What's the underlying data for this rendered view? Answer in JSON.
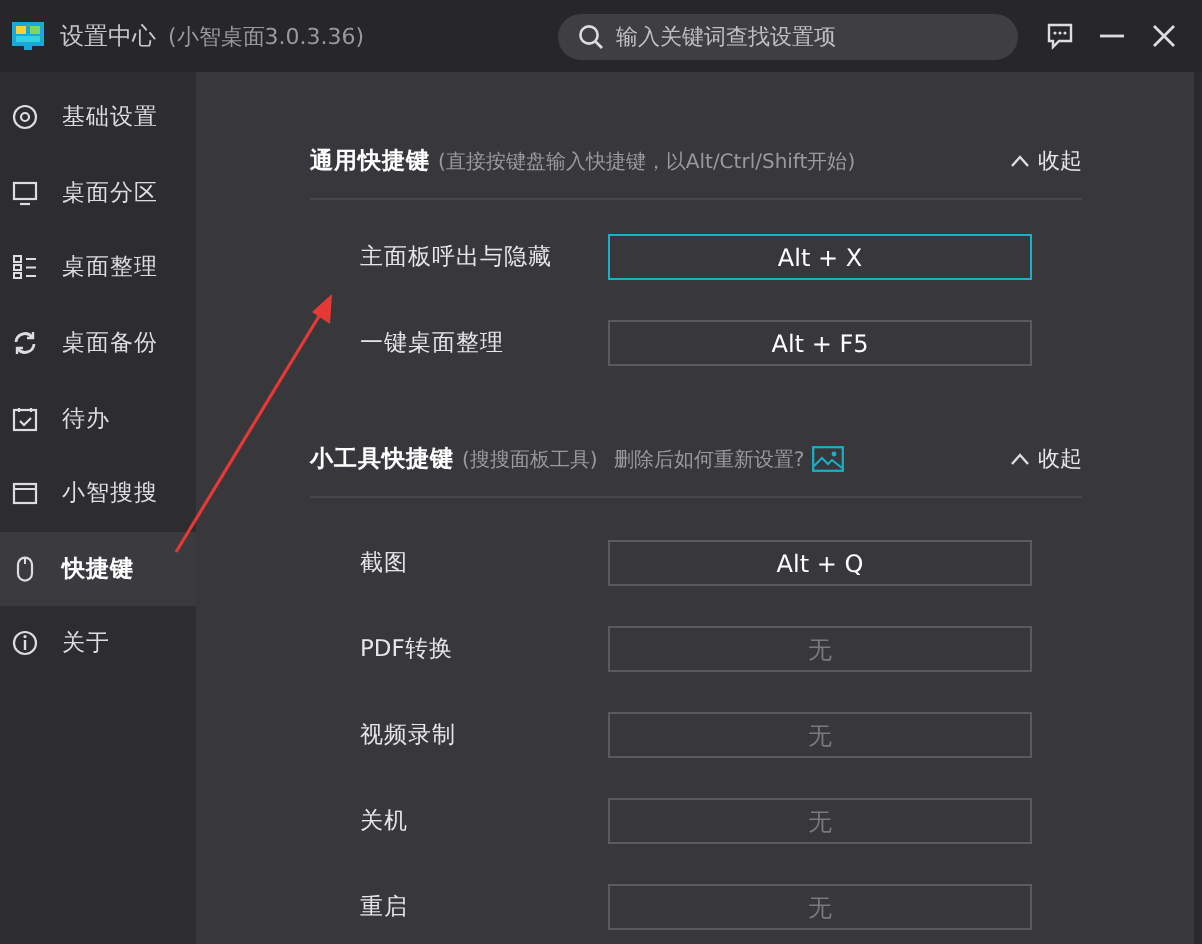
{
  "window": {
    "title": "设置中心",
    "subtitle": "(小智桌面3.0.3.36)"
  },
  "search": {
    "placeholder": "输入关键词查找设置项"
  },
  "sidebar": {
    "items": [
      {
        "label": "基础设置",
        "selected": false
      },
      {
        "label": "桌面分区",
        "selected": false
      },
      {
        "label": "桌面整理",
        "selected": false
      },
      {
        "label": "桌面备份",
        "selected": false
      },
      {
        "label": "待办",
        "selected": false
      },
      {
        "label": "小智搜搜",
        "selected": false
      },
      {
        "label": "快捷键",
        "selected": true
      },
      {
        "label": "关于",
        "selected": false
      }
    ]
  },
  "sections": [
    {
      "title": "通用快捷键",
      "hint": "(直接按键盘输入快捷键，以Alt/Ctrl/Shift开始)",
      "collapse": "收起",
      "rows": [
        {
          "label": "主面板呼出与隐藏",
          "value": "Alt + X",
          "focused": true
        },
        {
          "label": "一键桌面整理",
          "value": "Alt + F5",
          "focused": false
        }
      ]
    },
    {
      "title": "小工具快捷键",
      "hint": "(搜搜面板工具)",
      "help": "删除后如何重新设置?",
      "collapse": "收起",
      "rows": [
        {
          "label": "截图",
          "value": "Alt + Q",
          "focused": false
        },
        {
          "label": "PDF转换",
          "placeholder": "无",
          "focused": false
        },
        {
          "label": "视频录制",
          "placeholder": "无",
          "focused": false
        },
        {
          "label": "关机",
          "placeholder": "无",
          "focused": false
        },
        {
          "label": "重启",
          "placeholder": "无",
          "focused": false
        }
      ]
    }
  ]
}
